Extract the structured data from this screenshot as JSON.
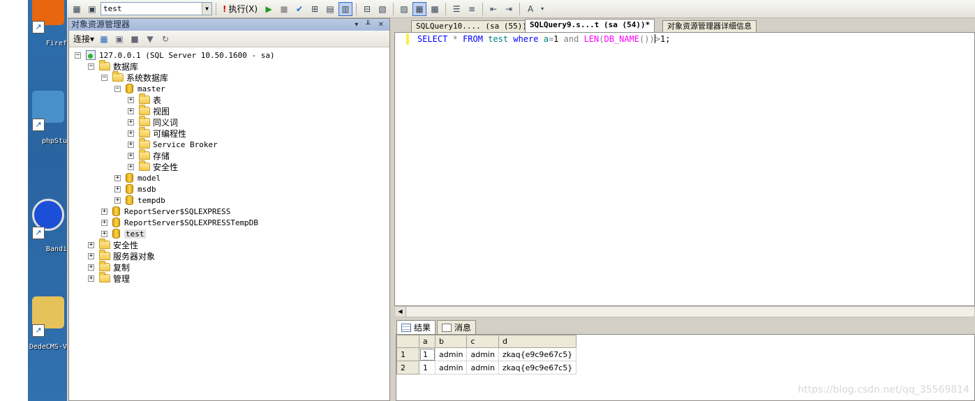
{
  "desktop": {
    "icons": [
      {
        "label": "Firef",
        "color": "#e8660f"
      },
      {
        "label": "phpStu",
        "color": "#4a90c8"
      },
      {
        "label": "Bandi",
        "color": "#1c4fd8"
      },
      {
        "label": "DedeCMS-V",
        "color": "#e6c25a"
      }
    ]
  },
  "toolbar": {
    "database": "test",
    "execute_label": "执行(X)"
  },
  "object_explorer": {
    "title": "对象资源管理器",
    "connect_label": "连接",
    "connect_arrow": "▾",
    "tree": [
      {
        "label": "127.0.0.1 (SQL Server 10.50.1600 - sa)",
        "level": 0,
        "expander": "−",
        "icon": "server"
      },
      {
        "label": "数据库",
        "level": 1,
        "expander": "−",
        "icon": "folder"
      },
      {
        "label": "系统数据库",
        "level": 2,
        "expander": "−",
        "icon": "folder"
      },
      {
        "label": "master",
        "level": 3,
        "expander": "−",
        "icon": "db"
      },
      {
        "label": "表",
        "level": 4,
        "expander": "+",
        "icon": "folder"
      },
      {
        "label": "视图",
        "level": 4,
        "expander": "+",
        "icon": "folder"
      },
      {
        "label": "同义词",
        "level": 4,
        "expander": "+",
        "icon": "folder"
      },
      {
        "label": "可编程性",
        "level": 4,
        "expander": "+",
        "icon": "folder"
      },
      {
        "label": "Service Broker",
        "level": 4,
        "expander": "+",
        "icon": "folder"
      },
      {
        "label": "存储",
        "level": 4,
        "expander": "+",
        "icon": "folder"
      },
      {
        "label": "安全性",
        "level": 4,
        "expander": "+",
        "icon": "folder"
      },
      {
        "label": "model",
        "level": 3,
        "expander": "+",
        "icon": "db"
      },
      {
        "label": "msdb",
        "level": 3,
        "expander": "+",
        "icon": "db"
      },
      {
        "label": "tempdb",
        "level": 3,
        "expander": "+",
        "icon": "db"
      },
      {
        "label": "ReportServer$SQLEXPRESS",
        "level": 2,
        "expander": "+",
        "icon": "db"
      },
      {
        "label": "ReportServer$SQLEXPRESSTempDB",
        "level": 2,
        "expander": "+",
        "icon": "db"
      },
      {
        "label": "test",
        "level": 2,
        "expander": "+",
        "icon": "db",
        "selected": true
      },
      {
        "label": "安全性",
        "level": 1,
        "expander": "+",
        "icon": "folder"
      },
      {
        "label": "服务器对象",
        "level": 1,
        "expander": "+",
        "icon": "folder"
      },
      {
        "label": "复制",
        "level": 1,
        "expander": "+",
        "icon": "folder"
      },
      {
        "label": "管理",
        "level": 1,
        "expander": "+",
        "icon": "folder"
      }
    ]
  },
  "tabs": [
    {
      "label": "SQLQuery10.... (sa (55))*",
      "active": false
    },
    {
      "label": "SQLQuery9.s...t (sa (54))*",
      "active": true
    },
    {
      "label": "对象资源管理器详细信息",
      "active": false
    }
  ],
  "editor": {
    "sql_tokens": [
      {
        "t": "SELECT",
        "c": "kw"
      },
      {
        "t": " ",
        "c": ""
      },
      {
        "t": "*",
        "c": "op"
      },
      {
        "t": " ",
        "c": ""
      },
      {
        "t": "FROM",
        "c": "kw"
      },
      {
        "t": " ",
        "c": ""
      },
      {
        "t": "test",
        "c": "id"
      },
      {
        "t": " ",
        "c": ""
      },
      {
        "t": "where",
        "c": "kw"
      },
      {
        "t": " ",
        "c": ""
      },
      {
        "t": "a",
        "c": "id"
      },
      {
        "t": "=",
        "c": "op"
      },
      {
        "t": "1",
        "c": ""
      },
      {
        "t": " ",
        "c": ""
      },
      {
        "t": "and",
        "c": "op"
      },
      {
        "t": " ",
        "c": ""
      },
      {
        "t": "LEN",
        "c": "fn"
      },
      {
        "t": "(",
        "c": "op"
      },
      {
        "t": "DB_NAME",
        "c": "fn"
      },
      {
        "t": "())",
        "c": "op"
      },
      {
        "t": "CARET",
        "c": "caret"
      },
      {
        "t": ">",
        "c": "op"
      },
      {
        "t": "1;",
        "c": ""
      }
    ]
  },
  "results": {
    "tab_results": "结果",
    "tab_messages": "消息",
    "columns": [
      "a",
      "b",
      "c",
      "d"
    ],
    "rows": [
      [
        "1",
        "1",
        "admin",
        "admin",
        "zkaq{e9c9e67c5}"
      ],
      [
        "2",
        "1",
        "admin",
        "admin",
        "zkaq{e9c9e67c5}"
      ]
    ]
  },
  "watermark": "https://blog.csdn.net/qq_35569814"
}
